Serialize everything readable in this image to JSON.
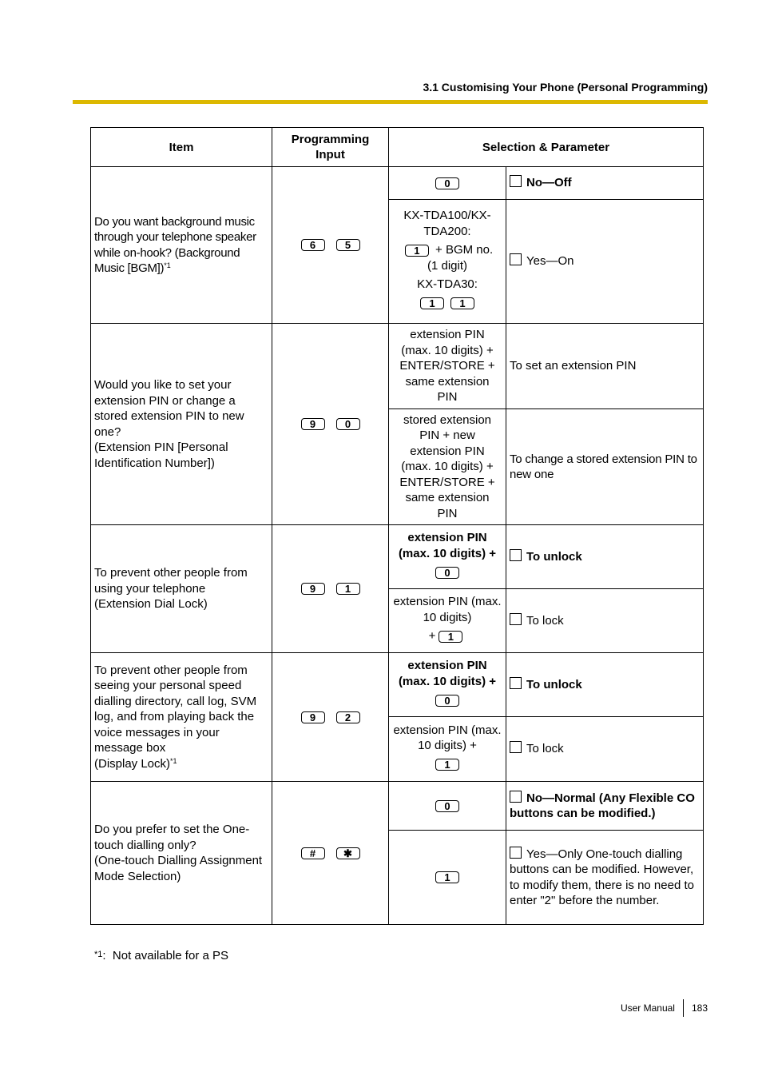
{
  "header": {
    "section_title": "3.1 Customising Your Phone (Personal Programming)",
    "rule_color": "#dcb800"
  },
  "table": {
    "columns": [
      "Item",
      "Programming Input",
      "Selection & Parameter"
    ],
    "rows": [
      {
        "item": "Do you want background music through your telephone speaker while on-hook? (Background Music [BGM])",
        "item_note": "*1",
        "input_keys": [
          "6",
          "5"
        ],
        "options": [
          {
            "selection_keys": [
              "0"
            ],
            "parameter": "No—Off",
            "parameter_bold": true,
            "checkbox": true
          },
          {
            "selection_lines": {
              "model_a": "KX-TDA100/KX-TDA200:",
              "key_a": "1",
              "suffix_a": "+ BGM no.",
              "suffix_a2": "(1 digit)",
              "model_b": "KX-TDA30:",
              "keys_b": [
                "1",
                "1"
              ]
            },
            "parameter": "Yes—On",
            "parameter_bold": false,
            "checkbox": true
          }
        ]
      },
      {
        "item_lines": [
          "Would you like to set your extension PIN or change a stored extension PIN to new one?",
          "(Extension PIN [Personal Identification Number])"
        ],
        "input_keys": [
          "9",
          "0"
        ],
        "options": [
          {
            "selection_text": "extension PIN (max. 10 digits) + ENTER/STORE + same extension PIN",
            "parameter": "To set an extension PIN",
            "checkbox": false
          },
          {
            "selection_text": "stored extension PIN + new extension PIN (max. 10 digits) + ENTER/STORE + same extension PIN",
            "parameter": "To change a stored extension PIN to new one",
            "checkbox": false
          }
        ]
      },
      {
        "item_lines": [
          "To prevent other people from using your telephone",
          "(Extension Dial Lock)"
        ],
        "input_keys": [
          "9",
          "1"
        ],
        "options": [
          {
            "selection_text": "extension PIN (max. 10 digits) +",
            "selection_bold": true,
            "selection_key": "0",
            "parameter": "To unlock",
            "parameter_bold": true,
            "checkbox": true
          },
          {
            "selection_text": "extension PIN (max. 10 digits)",
            "selection_prefix": "+",
            "selection_key": "1",
            "parameter": "To lock",
            "parameter_bold": false,
            "checkbox": true
          }
        ]
      },
      {
        "item_lines": [
          "To prevent other people from seeing your personal speed dialling directory, call log, SVM log, and from playing back the voice messages in your message box",
          "(Display Lock)"
        ],
        "item_note": "*1",
        "input_keys": [
          "9",
          "2"
        ],
        "options": [
          {
            "selection_text": "extension PIN (max. 10 digits) +",
            "selection_bold": true,
            "selection_key": "0",
            "parameter": "To unlock",
            "parameter_bold": true,
            "checkbox": true
          },
          {
            "selection_text": "extension PIN (max. 10 digits) +",
            "selection_key": "1",
            "parameter": "To lock",
            "parameter_bold": false,
            "checkbox": true
          }
        ]
      },
      {
        "item_lines": [
          "Do you prefer to set the One-touch dialling only?",
          "(One-touch Dialling Assignment Mode Selection)"
        ],
        "input_keys": [
          "#",
          "✱"
        ],
        "options": [
          {
            "selection_key": "0",
            "parameter": "No—Normal (Any Flexible CO buttons can be modified.)",
            "parameter_bold": true,
            "checkbox": true
          },
          {
            "selection_key": "1",
            "parameter": "Yes—Only One-touch dialling buttons can be modified. However, to modify them, there is no need to enter \"2\" before the number.",
            "parameter_bold": false,
            "checkbox": true
          }
        ]
      }
    ]
  },
  "footnote": {
    "mark": "*1",
    "separator": ":",
    "text": "Not available for a PS"
  },
  "footer": {
    "label": "User Manual",
    "page_number": "183"
  }
}
